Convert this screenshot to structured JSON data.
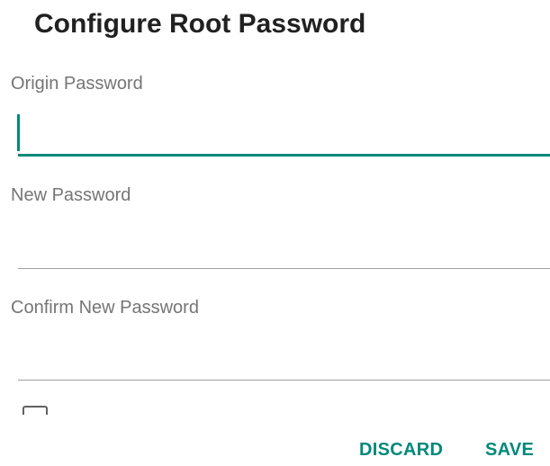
{
  "dialog": {
    "title": "Configure Root Password",
    "fields": [
      {
        "label": "Origin Password",
        "value": "",
        "focused": true
      },
      {
        "label": "New Password",
        "value": "",
        "focused": false
      },
      {
        "label": "Confirm New Password",
        "value": "",
        "focused": false
      }
    ],
    "show_password_checkbox": {
      "checked": false
    },
    "actions": {
      "discard_label": "DISCARD",
      "save_label": "SAVE"
    }
  },
  "colors": {
    "accent": "#00897b",
    "title_text": "#212121",
    "label_text": "#757575",
    "underline": "#9e9e9e"
  }
}
